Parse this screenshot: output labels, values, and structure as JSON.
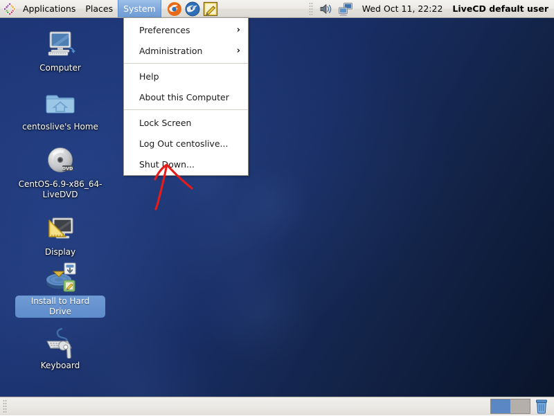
{
  "top_panel": {
    "logo_icon": "centos-logo-icon",
    "menus": [
      {
        "label": "Applications",
        "active": false
      },
      {
        "label": "Places",
        "active": false
      },
      {
        "label": "System",
        "active": true
      }
    ],
    "launchers": [
      {
        "name": "firefox-launcher",
        "title": "Firefox Web Browser"
      },
      {
        "name": "thunderbird-launcher",
        "title": "Thunderbird Mail"
      },
      {
        "name": "text-editor-launcher",
        "title": "gedit Text Editor"
      }
    ],
    "tray": [
      {
        "name": "volume-icon"
      },
      {
        "name": "network-icon"
      }
    ],
    "clock": "Wed Oct 11, 22:22",
    "user": "LiveCD default user"
  },
  "system_menu": {
    "items": [
      {
        "label": "Preferences",
        "submenu": true,
        "chevron": "›"
      },
      {
        "label": "Administration",
        "submenu": true,
        "chevron": "›"
      },
      {
        "separator": true
      },
      {
        "label": "Help",
        "submenu": false
      },
      {
        "label": "About this Computer",
        "submenu": false
      },
      {
        "separator": true
      },
      {
        "label": "Lock Screen",
        "submenu": false
      },
      {
        "label": "Log Out centoslive...",
        "submenu": false
      },
      {
        "label": "Shut Down...",
        "submenu": false
      }
    ]
  },
  "desktop_icons": [
    {
      "label": "Computer",
      "icon": "computer-icon",
      "selected": false
    },
    {
      "label": "centoslive's Home",
      "icon": "home-folder-icon",
      "selected": false
    },
    {
      "label": "CentOS-6.9-x86_64-LiveDVD",
      "icon": "dvd-disc-icon",
      "selected": false
    },
    {
      "label": "Display",
      "icon": "display-settings-icon",
      "selected": false
    },
    {
      "label": "Install to Hard Drive",
      "icon": "install-harddrive-icon",
      "selected": true
    },
    {
      "label": "Keyboard",
      "icon": "keyboard-settings-icon",
      "selected": false
    }
  ],
  "annotation": {
    "name": "red-arrow-annotation",
    "color": "#e81b1b",
    "points_at": "Shut Down..."
  },
  "bottom_panel": {
    "workspaces": [
      {
        "name": "workspace-1",
        "active": true
      },
      {
        "name": "workspace-2",
        "active": false
      }
    ],
    "trash": "trash-icon"
  },
  "colors": {
    "desktop_top": "#1b3372",
    "desktop_bottom": "#0a1328",
    "panel_bg": "#ece9e5",
    "menu_highlight": "#7fa9dd",
    "selection_blue": "#5f8ccb",
    "annotation_red": "#e81b1b"
  }
}
